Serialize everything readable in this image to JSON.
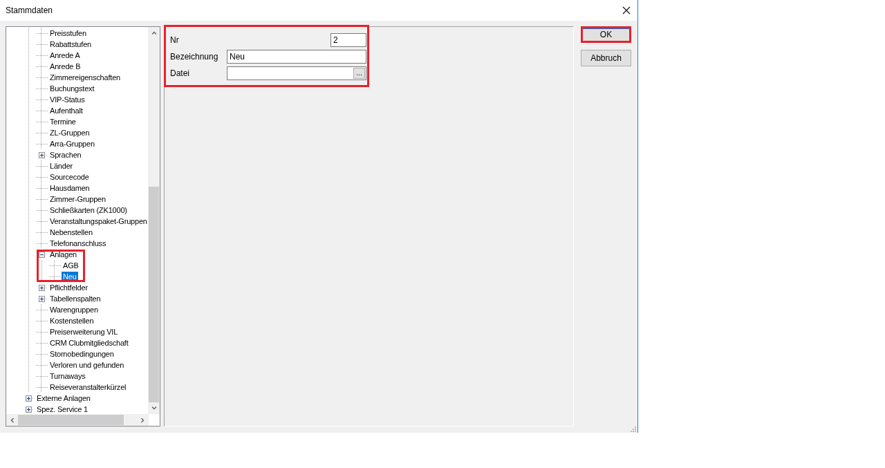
{
  "window": {
    "title": "Stammdaten"
  },
  "tree": {
    "items": [
      {
        "kind": "hidden",
        "children": [
          {
            "label": "Preisstufen",
            "kind": "leaf",
            "selected": false
          },
          {
            "label": "Rabattstufen",
            "kind": "leaf",
            "selected": false
          },
          {
            "label": "Anrede A",
            "kind": "leaf",
            "selected": false
          },
          {
            "label": "Anrede B",
            "kind": "leaf",
            "selected": false
          },
          {
            "label": "Zimmereigenschaften",
            "kind": "leaf",
            "selected": false
          },
          {
            "label": "Buchungstext",
            "kind": "leaf",
            "selected": false
          },
          {
            "label": "VIP-Status",
            "kind": "leaf",
            "selected": false
          },
          {
            "label": "Aufenthalt",
            "kind": "leaf",
            "selected": false
          },
          {
            "label": "Termine",
            "kind": "leaf",
            "selected": false
          },
          {
            "label": "ZL-Gruppen",
            "kind": "leaf",
            "selected": false
          },
          {
            "label": "Arra-Gruppen",
            "kind": "leaf",
            "selected": false
          },
          {
            "label": "Sprachen",
            "kind": "folder",
            "expanded": false,
            "selected": false
          },
          {
            "label": "Länder",
            "kind": "leaf",
            "selected": false
          },
          {
            "label": "Sourcecode",
            "kind": "leaf",
            "selected": false
          },
          {
            "label": "Hausdamen",
            "kind": "leaf",
            "selected": false
          },
          {
            "label": "Zimmer-Gruppen",
            "kind": "leaf",
            "selected": false
          },
          {
            "label": "Schließkarten (ZK1000)",
            "kind": "leaf",
            "selected": false
          },
          {
            "label": "Veranstaltungspaket-Gruppen",
            "kind": "leaf",
            "selected": false
          },
          {
            "label": "Nebenstellen",
            "kind": "leaf",
            "selected": false
          },
          {
            "label": "Telefonanschluss",
            "kind": "leaf",
            "selected": false
          },
          {
            "label": "Anlagen",
            "kind": "folder",
            "expanded": true,
            "selected": false,
            "children": [
              {
                "label": "AGB",
                "kind": "leaf",
                "selected": false
              },
              {
                "label": "Neu",
                "kind": "leaf",
                "selected": true
              }
            ]
          },
          {
            "label": "Pflichtfelder",
            "kind": "folder",
            "expanded": false,
            "selected": false
          },
          {
            "label": "Tabellenspalten",
            "kind": "folder",
            "expanded": false,
            "selected": false
          },
          {
            "label": "Warengruppen",
            "kind": "leaf",
            "selected": false
          },
          {
            "label": "Kostenstellen",
            "kind": "leaf",
            "selected": false
          },
          {
            "label": "Preiserweiterung VIL",
            "kind": "leaf",
            "selected": false
          },
          {
            "label": "CRM Clubmitgliedschaft",
            "kind": "leaf",
            "selected": false
          },
          {
            "label": "Stornobedingungen",
            "kind": "leaf",
            "selected": false
          },
          {
            "label": "Verloren und gefunden",
            "kind": "leaf",
            "selected": false
          },
          {
            "label": "Turnaways",
            "kind": "leaf",
            "selected": false
          },
          {
            "label": "Reiseveranstalterkürzel",
            "kind": "leaf",
            "selected": false
          }
        ]
      },
      {
        "label": "Externe Anlagen",
        "kind": "folder",
        "expanded": false,
        "selected": false
      },
      {
        "label": "Spez. Service 1",
        "kind": "folder",
        "expanded": false,
        "selected": false
      }
    ]
  },
  "form": {
    "nr": {
      "label": "Nr",
      "value": "2"
    },
    "bezeichnung": {
      "label": "Bezeichnung",
      "value": "Neu"
    },
    "datei": {
      "label": "Datei",
      "browse": "..."
    }
  },
  "buttons": [
    {
      "label": "OK",
      "highlighted": true
    },
    {
      "label": "Abbruch",
      "highlighted": false
    }
  ]
}
